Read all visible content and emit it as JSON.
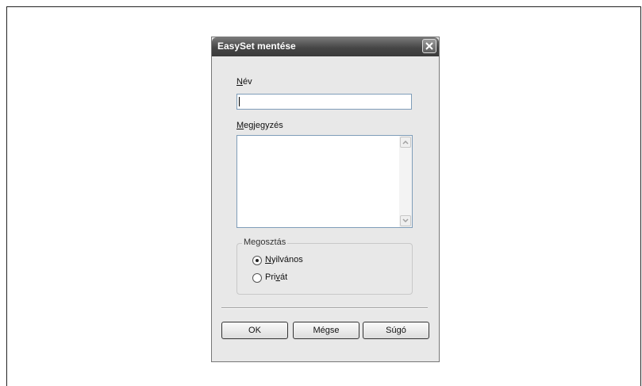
{
  "dialog": {
    "title": "EasySet mentése"
  },
  "form": {
    "name_label_key": "N",
    "name_label_rest": "év",
    "name_value": "",
    "comment_label_key": "M",
    "comment_label_rest": "egjegyzés",
    "comment_value": ""
  },
  "sharing": {
    "legend": "Megosztás",
    "options": [
      {
        "key": "N",
        "rest": "yilvános",
        "selected": true
      },
      {
        "pre": "Pri",
        "key": "v",
        "rest": "át",
        "selected": false
      }
    ]
  },
  "buttons": {
    "ok": "OK",
    "cancel": "Mégse",
    "help": "Súgó"
  },
  "icons": {
    "close": "close-icon",
    "scroll_up": "chevron-up-icon",
    "scroll_down": "chevron-down-icon"
  }
}
